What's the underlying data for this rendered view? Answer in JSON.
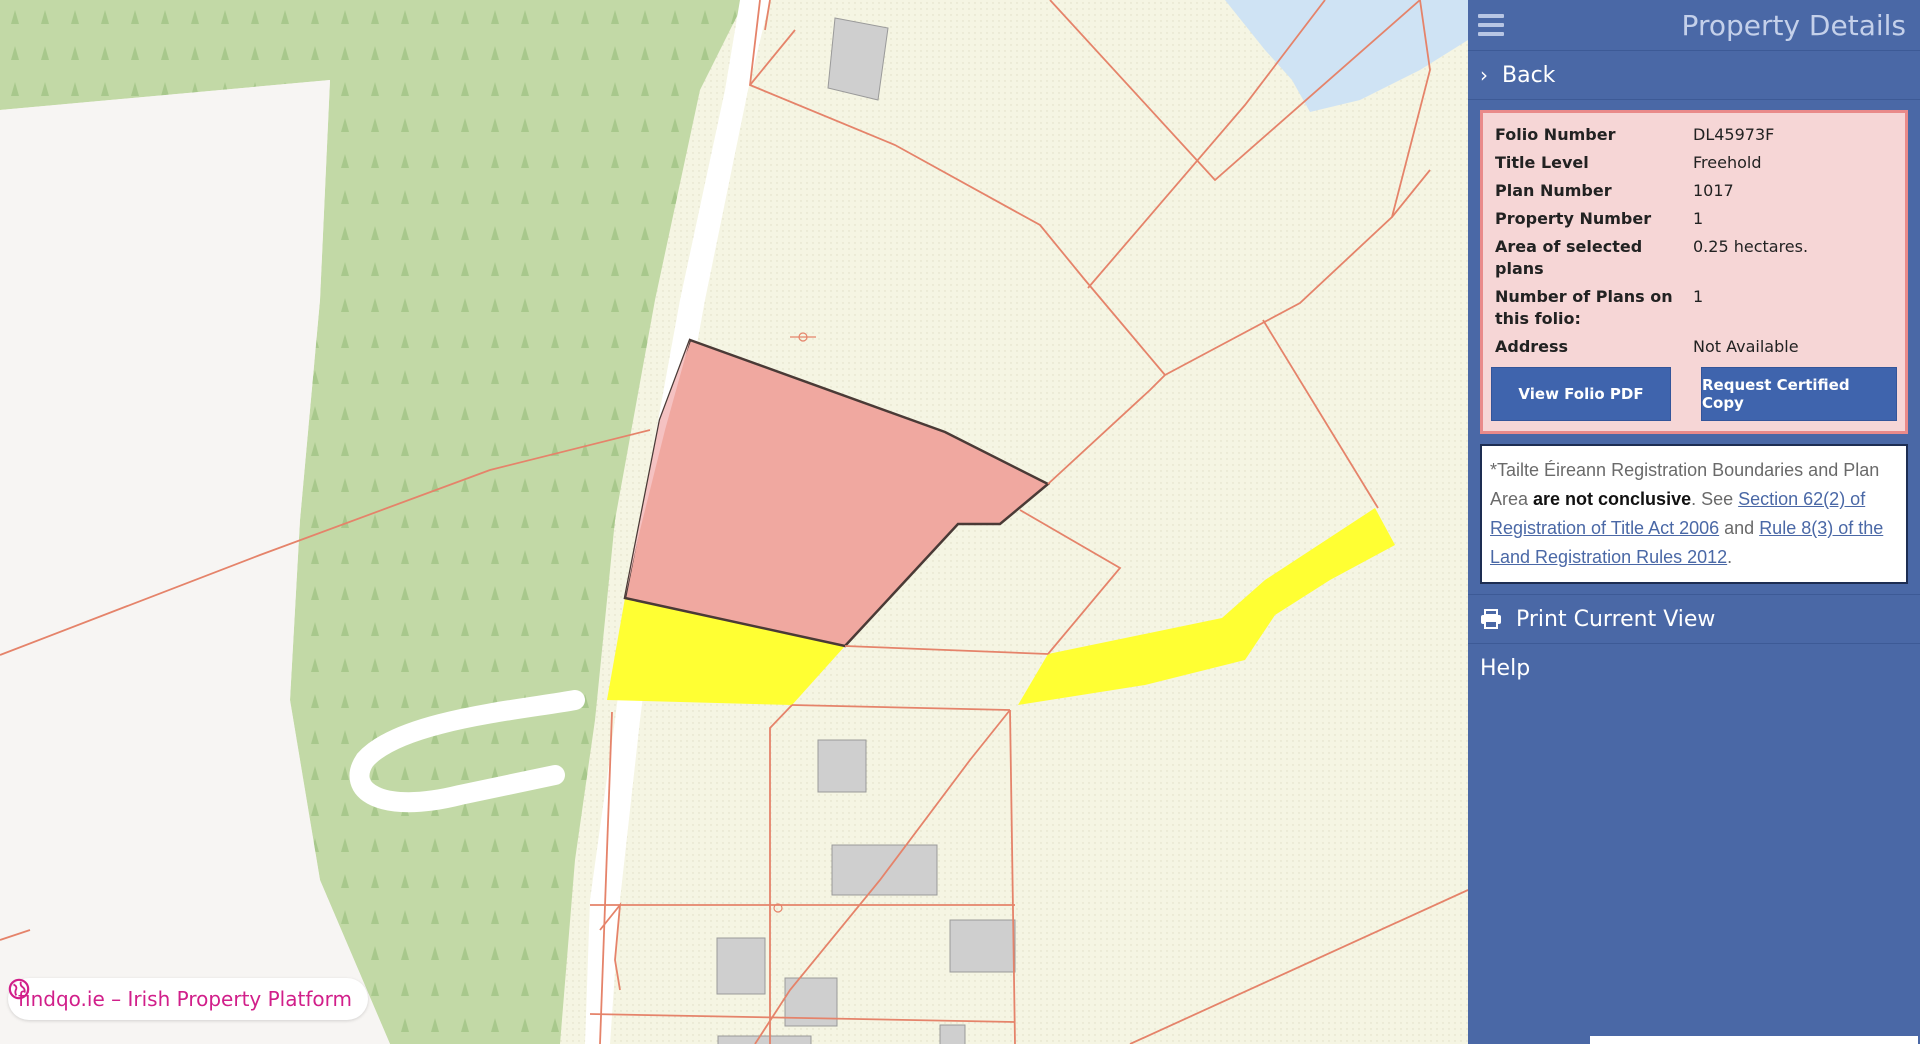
{
  "sidebar": {
    "title": "Property Details",
    "back_label": "Back",
    "details": [
      {
        "label": "Folio Number",
        "value": "DL45973F"
      },
      {
        "label": "Title Level",
        "value": "Freehold"
      },
      {
        "label": "Plan Number",
        "value": "1017"
      },
      {
        "label": "Property Number",
        "value": "1"
      },
      {
        "label": "Area of selected plans",
        "value": "0.25 hectares."
      },
      {
        "label": "Number of Plans on this folio:",
        "value": "1"
      },
      {
        "label": "Address",
        "value": "Not Available"
      }
    ],
    "buttons": {
      "view_pdf": "View Folio PDF",
      "request_copy": "Request Certified Copy"
    },
    "disclaimer": {
      "part1": "*Tailte Éireann Registration Boundaries and Plan Area ",
      "bold": "are not conclusive",
      "part2": ". See ",
      "link1": "Section 62(2) of Registration of Title Act 2006",
      "part3": " and ",
      "link2": "Rule 8(3) of the Land Registration Rules 2012",
      "part4": "."
    },
    "print_label": "Print Current View",
    "help_label": "Help"
  },
  "map": {
    "watermark": "findqo.ie – Irish Property Platform",
    "colors": {
      "selected_parcel": "#f0a8a0",
      "highlight": "#ffff33",
      "boundary": "#e5836a",
      "forest": "#c2d9a6",
      "water": "#cfe3f4"
    }
  }
}
